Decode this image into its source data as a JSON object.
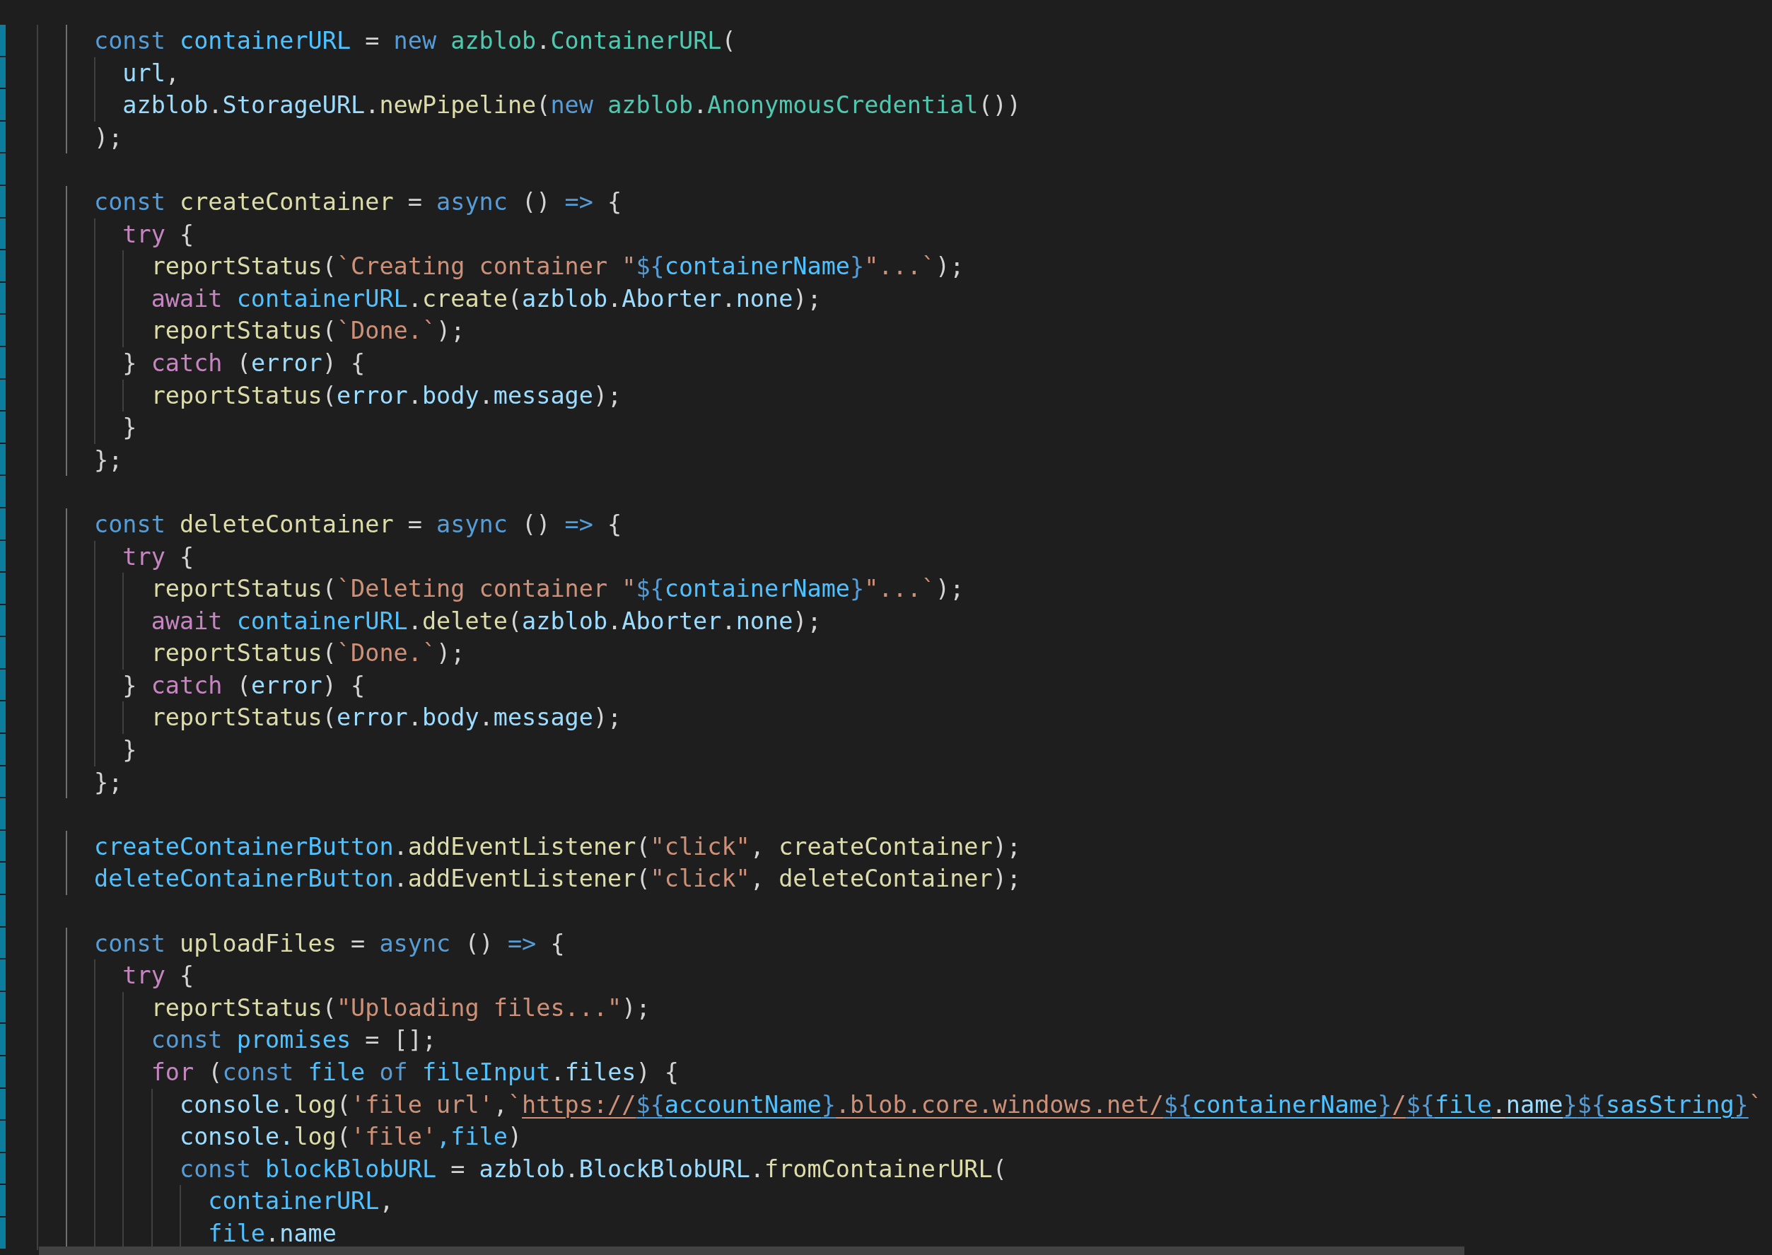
{
  "editor": {
    "lines": [
      {
        "modified": true,
        "tokens": [
          {
            "text": "      const ",
            "kind": "keyword"
          },
          {
            "text": "containerURL",
            "kind": "constant"
          },
          {
            "text": " = ",
            "kind": "punct"
          },
          {
            "text": "new ",
            "kind": "keyword"
          },
          {
            "text": "azblob",
            "kind": "class"
          },
          {
            "text": ".",
            "kind": "punct"
          },
          {
            "text": "ContainerURL",
            "kind": "class"
          },
          {
            "text": "(",
            "kind": "punct"
          }
        ]
      },
      {
        "modified": true,
        "tokens": [
          {
            "text": "        url",
            "kind": "variable"
          },
          {
            "text": ",",
            "kind": "punct"
          }
        ]
      },
      {
        "modified": true,
        "tokens": [
          {
            "text": "        azblob",
            "kind": "variable"
          },
          {
            "text": ".",
            "kind": "punct"
          },
          {
            "text": "StorageURL",
            "kind": "variable"
          },
          {
            "text": ".",
            "kind": "punct"
          },
          {
            "text": "newPipeline",
            "kind": "function"
          },
          {
            "text": "(",
            "kind": "punct"
          },
          {
            "text": "new ",
            "kind": "keyword"
          },
          {
            "text": "azblob",
            "kind": "class"
          },
          {
            "text": ".",
            "kind": "punct"
          },
          {
            "text": "AnonymousCredential",
            "kind": "class"
          },
          {
            "text": "())",
            "kind": "punct"
          }
        ]
      },
      {
        "modified": true,
        "tokens": [
          {
            "text": "      );",
            "kind": "punct"
          }
        ]
      },
      {
        "modified": true
      },
      {
        "modified": true,
        "tokens": [
          {
            "text": "      const ",
            "kind": "keyword"
          },
          {
            "text": "createContainer",
            "kind": "function"
          },
          {
            "text": " = ",
            "kind": "punct"
          },
          {
            "text": "async",
            "kind": "keyword"
          },
          {
            "text": " () ",
            "kind": "punct"
          },
          {
            "text": "=>",
            "kind": "keyword"
          },
          {
            "text": " {",
            "kind": "punct"
          }
        ]
      },
      {
        "modified": true,
        "tokens": [
          {
            "text": "        try",
            "kind": "control"
          },
          {
            "text": " {",
            "kind": "punct"
          }
        ]
      },
      {
        "modified": true,
        "tokens": [
          {
            "text": "          reportStatus",
            "kind": "function"
          },
          {
            "text": "(",
            "kind": "punct"
          },
          {
            "text": "`Creating container \"",
            "kind": "string"
          },
          {
            "text": "${",
            "kind": "keyword"
          },
          {
            "text": "containerName",
            "kind": "constant"
          },
          {
            "text": "}",
            "kind": "keyword"
          },
          {
            "text": "\"...`",
            "kind": "string"
          },
          {
            "text": ");",
            "kind": "punct"
          }
        ]
      },
      {
        "modified": true,
        "tokens": [
          {
            "text": "          await ",
            "kind": "control"
          },
          {
            "text": "containerURL",
            "kind": "constant"
          },
          {
            "text": ".",
            "kind": "punct"
          },
          {
            "text": "create",
            "kind": "function"
          },
          {
            "text": "(",
            "kind": "punct"
          },
          {
            "text": "azblob",
            "kind": "variable"
          },
          {
            "text": ".",
            "kind": "punct"
          },
          {
            "text": "Aborter",
            "kind": "variable"
          },
          {
            "text": ".",
            "kind": "punct"
          },
          {
            "text": "none",
            "kind": "variable"
          },
          {
            "text": ");",
            "kind": "punct"
          }
        ]
      },
      {
        "modified": true,
        "tokens": [
          {
            "text": "          reportStatus",
            "kind": "function"
          },
          {
            "text": "(",
            "kind": "punct"
          },
          {
            "text": "`Done.`",
            "kind": "string"
          },
          {
            "text": ");",
            "kind": "punct"
          }
        ]
      },
      {
        "modified": true,
        "tokens": [
          {
            "text": "        } ",
            "kind": "punct"
          },
          {
            "text": "catch",
            "kind": "control"
          },
          {
            "text": " (",
            "kind": "punct"
          },
          {
            "text": "error",
            "kind": "variable"
          },
          {
            "text": ") {",
            "kind": "punct"
          }
        ]
      },
      {
        "modified": true,
        "tokens": [
          {
            "text": "          reportStatus",
            "kind": "function"
          },
          {
            "text": "(",
            "kind": "punct"
          },
          {
            "text": "error",
            "kind": "variable"
          },
          {
            "text": ".",
            "kind": "punct"
          },
          {
            "text": "body",
            "kind": "variable"
          },
          {
            "text": ".",
            "kind": "punct"
          },
          {
            "text": "message",
            "kind": "variable"
          },
          {
            "text": ");",
            "kind": "punct"
          }
        ]
      },
      {
        "modified": true,
        "tokens": [
          {
            "text": "        }",
            "kind": "punct"
          }
        ]
      },
      {
        "modified": true,
        "tokens": [
          {
            "text": "      };",
            "kind": "punct"
          }
        ]
      },
      {
        "modified": true
      },
      {
        "modified": true,
        "tokens": [
          {
            "text": "      const ",
            "kind": "keyword"
          },
          {
            "text": "deleteContainer",
            "kind": "function"
          },
          {
            "text": " = ",
            "kind": "punct"
          },
          {
            "text": "async",
            "kind": "keyword"
          },
          {
            "text": " () ",
            "kind": "punct"
          },
          {
            "text": "=>",
            "kind": "keyword"
          },
          {
            "text": " {",
            "kind": "punct"
          }
        ]
      },
      {
        "modified": true,
        "tokens": [
          {
            "text": "        try",
            "kind": "control"
          },
          {
            "text": " {",
            "kind": "punct"
          }
        ]
      },
      {
        "modified": true,
        "tokens": [
          {
            "text": "          reportStatus",
            "kind": "function"
          },
          {
            "text": "(",
            "kind": "punct"
          },
          {
            "text": "`Deleting container \"",
            "kind": "string"
          },
          {
            "text": "${",
            "kind": "keyword"
          },
          {
            "text": "containerName",
            "kind": "constant"
          },
          {
            "text": "}",
            "kind": "keyword"
          },
          {
            "text": "\"...`",
            "kind": "string"
          },
          {
            "text": ");",
            "kind": "punct"
          }
        ]
      },
      {
        "modified": true,
        "tokens": [
          {
            "text": "          await ",
            "kind": "control"
          },
          {
            "text": "containerURL",
            "kind": "constant"
          },
          {
            "text": ".",
            "kind": "punct"
          },
          {
            "text": "delete",
            "kind": "function"
          },
          {
            "text": "(",
            "kind": "punct"
          },
          {
            "text": "azblob",
            "kind": "variable"
          },
          {
            "text": ".",
            "kind": "punct"
          },
          {
            "text": "Aborter",
            "kind": "variable"
          },
          {
            "text": ".",
            "kind": "punct"
          },
          {
            "text": "none",
            "kind": "variable"
          },
          {
            "text": ");",
            "kind": "punct"
          }
        ]
      },
      {
        "modified": true,
        "tokens": [
          {
            "text": "          reportStatus",
            "kind": "function"
          },
          {
            "text": "(",
            "kind": "punct"
          },
          {
            "text": "`Done.`",
            "kind": "string"
          },
          {
            "text": ");",
            "kind": "punct"
          }
        ]
      },
      {
        "modified": true,
        "tokens": [
          {
            "text": "        } ",
            "kind": "punct"
          },
          {
            "text": "catch",
            "kind": "control"
          },
          {
            "text": " (",
            "kind": "punct"
          },
          {
            "text": "error",
            "kind": "variable"
          },
          {
            "text": ") {",
            "kind": "punct"
          }
        ]
      },
      {
        "modified": true,
        "tokens": [
          {
            "text": "          reportStatus",
            "kind": "function"
          },
          {
            "text": "(",
            "kind": "punct"
          },
          {
            "text": "error",
            "kind": "variable"
          },
          {
            "text": ".",
            "kind": "punct"
          },
          {
            "text": "body",
            "kind": "variable"
          },
          {
            "text": ".",
            "kind": "punct"
          },
          {
            "text": "message",
            "kind": "variable"
          },
          {
            "text": ");",
            "kind": "punct"
          }
        ]
      },
      {
        "modified": true,
        "tokens": [
          {
            "text": "        }",
            "kind": "punct"
          }
        ]
      },
      {
        "modified": true,
        "tokens": [
          {
            "text": "      };",
            "kind": "punct"
          }
        ]
      },
      {
        "modified": true
      },
      {
        "modified": true,
        "tokens": [
          {
            "text": "      createContainerButton",
            "kind": "constant"
          },
          {
            "text": ".",
            "kind": "punct"
          },
          {
            "text": "addEventListener",
            "kind": "function"
          },
          {
            "text": "(",
            "kind": "punct"
          },
          {
            "text": "\"click\"",
            "kind": "string"
          },
          {
            "text": ", ",
            "kind": "punct"
          },
          {
            "text": "createContainer",
            "kind": "function"
          },
          {
            "text": ");",
            "kind": "punct"
          }
        ]
      },
      {
        "modified": true,
        "tokens": [
          {
            "text": "      deleteContainerButton",
            "kind": "constant"
          },
          {
            "text": ".",
            "kind": "punct"
          },
          {
            "text": "addEventListener",
            "kind": "function"
          },
          {
            "text": "(",
            "kind": "punct"
          },
          {
            "text": "\"click\"",
            "kind": "string"
          },
          {
            "text": ", ",
            "kind": "punct"
          },
          {
            "text": "deleteContainer",
            "kind": "function"
          },
          {
            "text": ");",
            "kind": "punct"
          }
        ]
      },
      {
        "modified": true
      },
      {
        "modified": true,
        "tokens": [
          {
            "text": "      const ",
            "kind": "keyword"
          },
          {
            "text": "uploadFiles",
            "kind": "function"
          },
          {
            "text": " = ",
            "kind": "punct"
          },
          {
            "text": "async",
            "kind": "keyword"
          },
          {
            "text": " () ",
            "kind": "punct"
          },
          {
            "text": "=>",
            "kind": "keyword"
          },
          {
            "text": " {",
            "kind": "punct"
          }
        ]
      },
      {
        "modified": true,
        "tokens": [
          {
            "text": "        try",
            "kind": "control"
          },
          {
            "text": " {",
            "kind": "punct"
          }
        ]
      },
      {
        "modified": true,
        "tokens": [
          {
            "text": "          reportStatus",
            "kind": "function"
          },
          {
            "text": "(",
            "kind": "punct"
          },
          {
            "text": "\"Uploading files...\"",
            "kind": "string"
          },
          {
            "text": ");",
            "kind": "punct"
          }
        ]
      },
      {
        "modified": true,
        "tokens": [
          {
            "text": "          const ",
            "kind": "keyword"
          },
          {
            "text": "promises",
            "kind": "constant"
          },
          {
            "text": " = [];",
            "kind": "punct"
          }
        ]
      },
      {
        "modified": true,
        "tokens": [
          {
            "text": "          for",
            "kind": "control"
          },
          {
            "text": " (",
            "kind": "punct"
          },
          {
            "text": "const ",
            "kind": "keyword"
          },
          {
            "text": "file ",
            "kind": "constant"
          },
          {
            "text": "of ",
            "kind": "keyword"
          },
          {
            "text": "fileInput",
            "kind": "constant"
          },
          {
            "text": ".",
            "kind": "punct"
          },
          {
            "text": "files",
            "kind": "variable"
          },
          {
            "text": ") {",
            "kind": "punct"
          }
        ]
      },
      {
        "modified": true,
        "tokens": [
          {
            "text": "            console",
            "kind": "variable"
          },
          {
            "text": ".",
            "kind": "punct"
          },
          {
            "text": "log",
            "kind": "function"
          },
          {
            "text": "(",
            "kind": "punct"
          },
          {
            "text": "'file url'",
            "kind": "string"
          },
          {
            "text": ",",
            "kind": "punct"
          },
          {
            "text": "`",
            "kind": "string"
          },
          {
            "text": "https://",
            "kind": "string",
            "link": true
          },
          {
            "text": "${",
            "kind": "keyword",
            "link": true
          },
          {
            "text": "accountName",
            "kind": "constant",
            "link": true
          },
          {
            "text": "}",
            "kind": "keyword",
            "link": true
          },
          {
            "text": ".blob.core.windows.net/",
            "kind": "string",
            "link": true
          },
          {
            "text": "${",
            "kind": "keyword",
            "link": true
          },
          {
            "text": "containerName",
            "kind": "constant",
            "link": true
          },
          {
            "text": "}",
            "kind": "keyword",
            "link": true
          },
          {
            "text": "/",
            "kind": "string",
            "link": true
          },
          {
            "text": "${",
            "kind": "keyword",
            "link": true
          },
          {
            "text": "file",
            "kind": "constant",
            "link": true
          },
          {
            "text": ".",
            "kind": "punct",
            "link": true
          },
          {
            "text": "name",
            "kind": "variable",
            "link": true
          },
          {
            "text": "}",
            "kind": "keyword",
            "link": true
          },
          {
            "text": "${",
            "kind": "keyword",
            "link": true
          },
          {
            "text": "sasString",
            "kind": "constant",
            "link": true
          },
          {
            "text": "}",
            "kind": "keyword",
            "link": true
          },
          {
            "text": "`",
            "kind": "string"
          }
        ]
      },
      {
        "modified": true,
        "tokens": [
          {
            "text": "            console.",
            "kind": "variable"
          },
          {
            "text": "log",
            "kind": "function"
          },
          {
            "text": "(",
            "kind": "punct"
          },
          {
            "text": "'file'",
            "kind": "string"
          },
          {
            "text": ",file",
            "kind": "constant"
          },
          {
            "text": ")",
            "kind": "punct"
          }
        ]
      },
      {
        "modified": true,
        "tokens": [
          {
            "text": "            const ",
            "kind": "keyword"
          },
          {
            "text": "blockBlobURL",
            "kind": "constant"
          },
          {
            "text": " = ",
            "kind": "punct"
          },
          {
            "text": "azblob",
            "kind": "variable"
          },
          {
            "text": ".",
            "kind": "punct"
          },
          {
            "text": "BlockBlobURL",
            "kind": "variable"
          },
          {
            "text": ".",
            "kind": "punct"
          },
          {
            "text": "fromContainerURL",
            "kind": "function"
          },
          {
            "text": "(",
            "kind": "punct"
          }
        ]
      },
      {
        "modified": true,
        "tokens": [
          {
            "text": "              containerURL",
            "kind": "constant"
          },
          {
            "text": ",",
            "kind": "punct"
          }
        ]
      },
      {
        "modified": true,
        "tokens": [
          {
            "text": "              file",
            "kind": "constant"
          },
          {
            "text": ".",
            "kind": "punct"
          },
          {
            "text": "name",
            "kind": "variable"
          }
        ]
      }
    ]
  }
}
